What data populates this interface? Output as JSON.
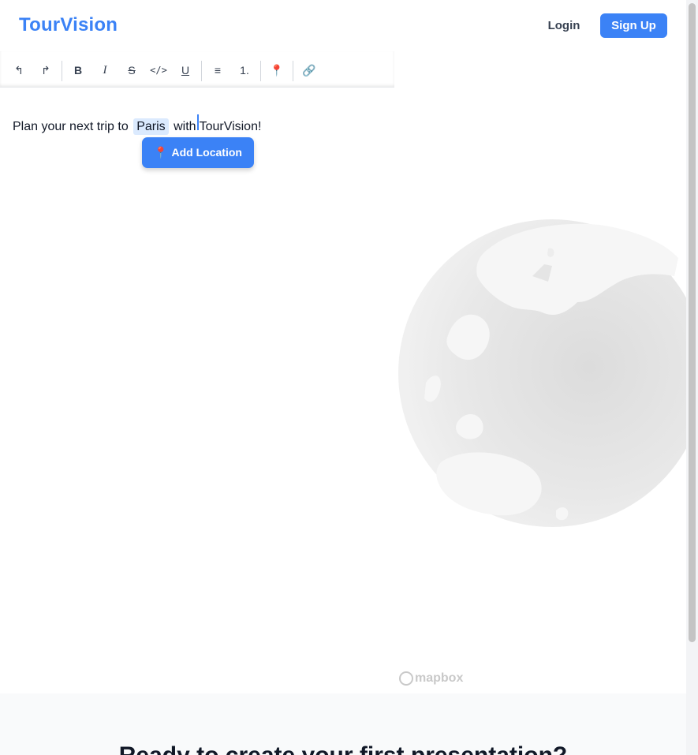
{
  "header": {
    "logo": "TourVision",
    "login_label": "Login",
    "signup_label": "Sign Up"
  },
  "toolbar": {
    "undo": "↰",
    "redo": "↱",
    "bold": "B",
    "italic": "I",
    "strike": "S",
    "code": "</>",
    "underline": "U",
    "bullet_list": "≡",
    "ordered_list": "1.",
    "location": "📍",
    "link": "🔗"
  },
  "editor": {
    "text_before": "Plan your next trip to",
    "location_chip": "Paris",
    "text_middle": "with",
    "text_after": "TourVision!",
    "add_location_label": "Add Location",
    "add_location_icon": "📍"
  },
  "map": {
    "attribution": "mapbox"
  },
  "bottom": {
    "heading": "Ready to create your first presentation?"
  },
  "colors": {
    "accent": "#3b82f6",
    "chip_bg": "#dbeafe"
  }
}
